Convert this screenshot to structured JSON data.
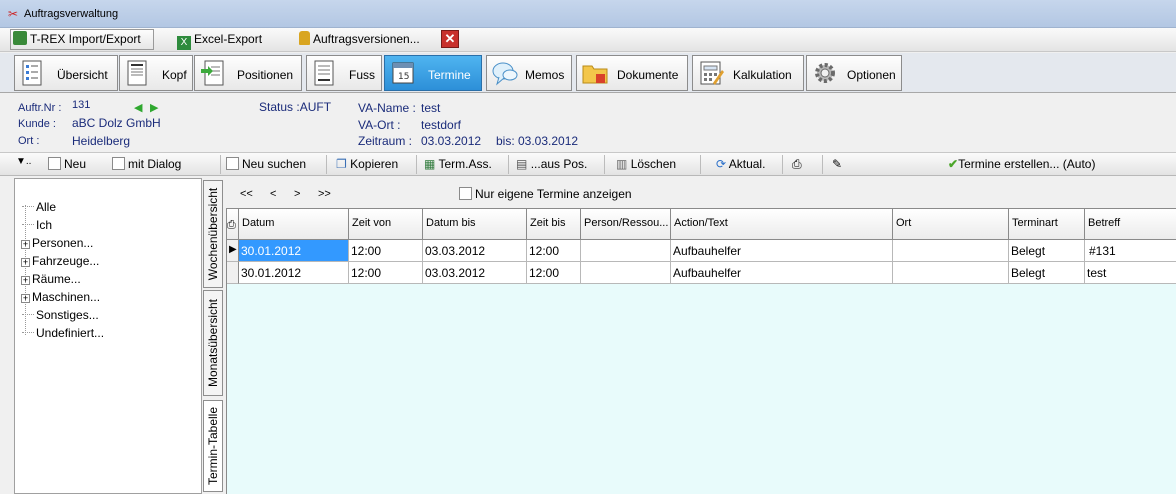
{
  "window": {
    "title": "Auftragsverwaltung"
  },
  "toolbar_top": {
    "trex": "T-REX Import/Export",
    "excel": "Excel-Export",
    "versions": "Auftragsversionen..."
  },
  "tabs": [
    {
      "label": "Übersicht"
    },
    {
      "label": "Kopf"
    },
    {
      "label": "Positionen"
    },
    {
      "label": "Fuss"
    },
    {
      "label": "Termine"
    },
    {
      "label": "Memos"
    },
    {
      "label": "Dokumente"
    },
    {
      "label": "Kalkulation"
    },
    {
      "label": "Optionen"
    }
  ],
  "info": {
    "auftr_label": "Auftr.Nr :",
    "auftr_value": "131",
    "kunde_label": "Kunde :",
    "kunde_value": "aBC Dolz GmbH",
    "ort_label": "Ort :",
    "ort_value": "Heidelberg",
    "status": "Status :AUFT",
    "va_name_label": "VA-Name :",
    "va_name_value": "test",
    "va_ort_label": "VA-Ort :",
    "va_ort_value": "testdorf",
    "zeitraum_label": "Zeitraum :",
    "zeitraum_value": "03.03.2012",
    "bis_label": "bis:",
    "bis_value": "03.03.2012"
  },
  "action_toolbar": {
    "neu": "Neu",
    "mit_dialog": "mit Dialog",
    "neu_suchen": "Neu suchen",
    "kopieren": "Kopieren",
    "term_ass": "Term.Ass.",
    "aus_pos": "...aus Pos.",
    "loeschen": "Löschen",
    "aktual": "Aktual.",
    "termine_erstellen": "Termine erstellen... (Auto)"
  },
  "tree": {
    "items": [
      "Alle",
      "Ich",
      "Personen...",
      "Fahrzeuge...",
      "Räume...",
      "Maschinen...",
      "Sonstiges...",
      "Undefiniert..."
    ]
  },
  "vertical_tabs": [
    "Wochenübersicht",
    "Monatsübersicht",
    "Termin-Tabelle"
  ],
  "grid": {
    "nav": [
      "<<",
      "<",
      ">",
      ">>"
    ],
    "own_only": "Nur eigene Termine anzeigen",
    "columns": [
      "Datum",
      "Zeit von",
      "Datum bis",
      "Zeit bis",
      "Person/Ressou...",
      "Action/Text",
      "Ort",
      "Terminart",
      "Betreff"
    ],
    "rows": [
      [
        "30.01.2012",
        "12:00",
        "03.03.2012",
        "12:00",
        "",
        "Aufbauhelfer",
        "",
        "Belegt",
        "#131"
      ],
      [
        "30.01.2012",
        "12:00",
        "03.03.2012",
        "12:00",
        "",
        "Aufbauhelfer",
        "",
        "Belegt",
        "test"
      ]
    ]
  },
  "colors": {
    "active_tab": "#2d8fd8",
    "grid_bg": "#e8fbfb",
    "selection": "#3399ff",
    "label_blue": "#1a2b7a"
  }
}
